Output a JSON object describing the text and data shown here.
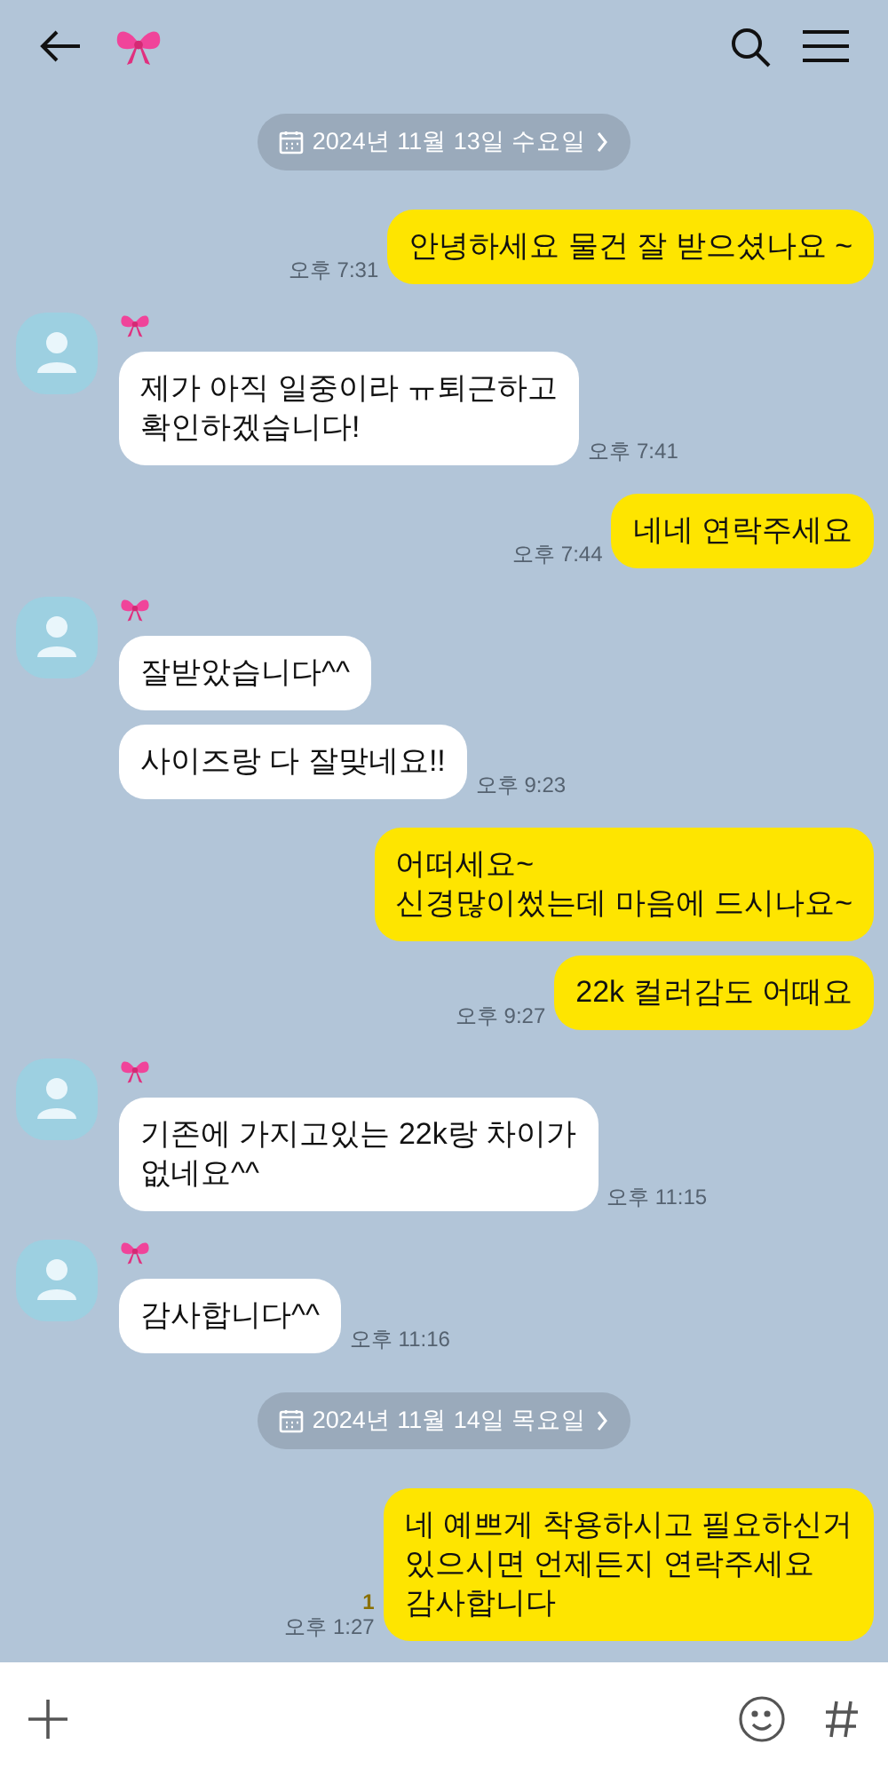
{
  "items": [
    {
      "kind": "date",
      "text": "2024년 11월 13일 수요일"
    },
    {
      "kind": "sent",
      "bubbles": [
        "안녕하세요 물건 잘 받으셨나요 ~"
      ],
      "time": "오후 7:31"
    },
    {
      "kind": "received",
      "bubbles": [
        "제가 아직 일중이라 ㅠ퇴근하고\n확인하겠습니다!"
      ],
      "time": "오후 7:41"
    },
    {
      "kind": "sent",
      "bubbles": [
        "네네 연락주세요"
      ],
      "time": "오후 7:44"
    },
    {
      "kind": "received",
      "bubbles": [
        "잘받았습니다^^",
        "사이즈랑 다 잘맞네요!!"
      ],
      "time": "오후 9:23"
    },
    {
      "kind": "sent",
      "bubbles": [
        "어떠세요~\n신경많이썼는데 마음에 드시나요~",
        "22k 컬러감도 어때요"
      ],
      "time": "오후 9:27"
    },
    {
      "kind": "received",
      "bubbles": [
        "기존에 가지고있는 22k랑 차이가\n없네요^^"
      ],
      "time": "오후 11:15"
    },
    {
      "kind": "received",
      "bubbles": [
        "감사합니다^^"
      ],
      "time": "오후 11:16"
    },
    {
      "kind": "date",
      "text": "2024년 11월 14일 목요일"
    },
    {
      "kind": "sent",
      "bubbles": [
        "네 예쁘게 착용하시고 필요하신거\n있으시면 언제든지 연락주세요\n감사합니다"
      ],
      "time": "오후 1:27",
      "unread": "1"
    }
  ]
}
